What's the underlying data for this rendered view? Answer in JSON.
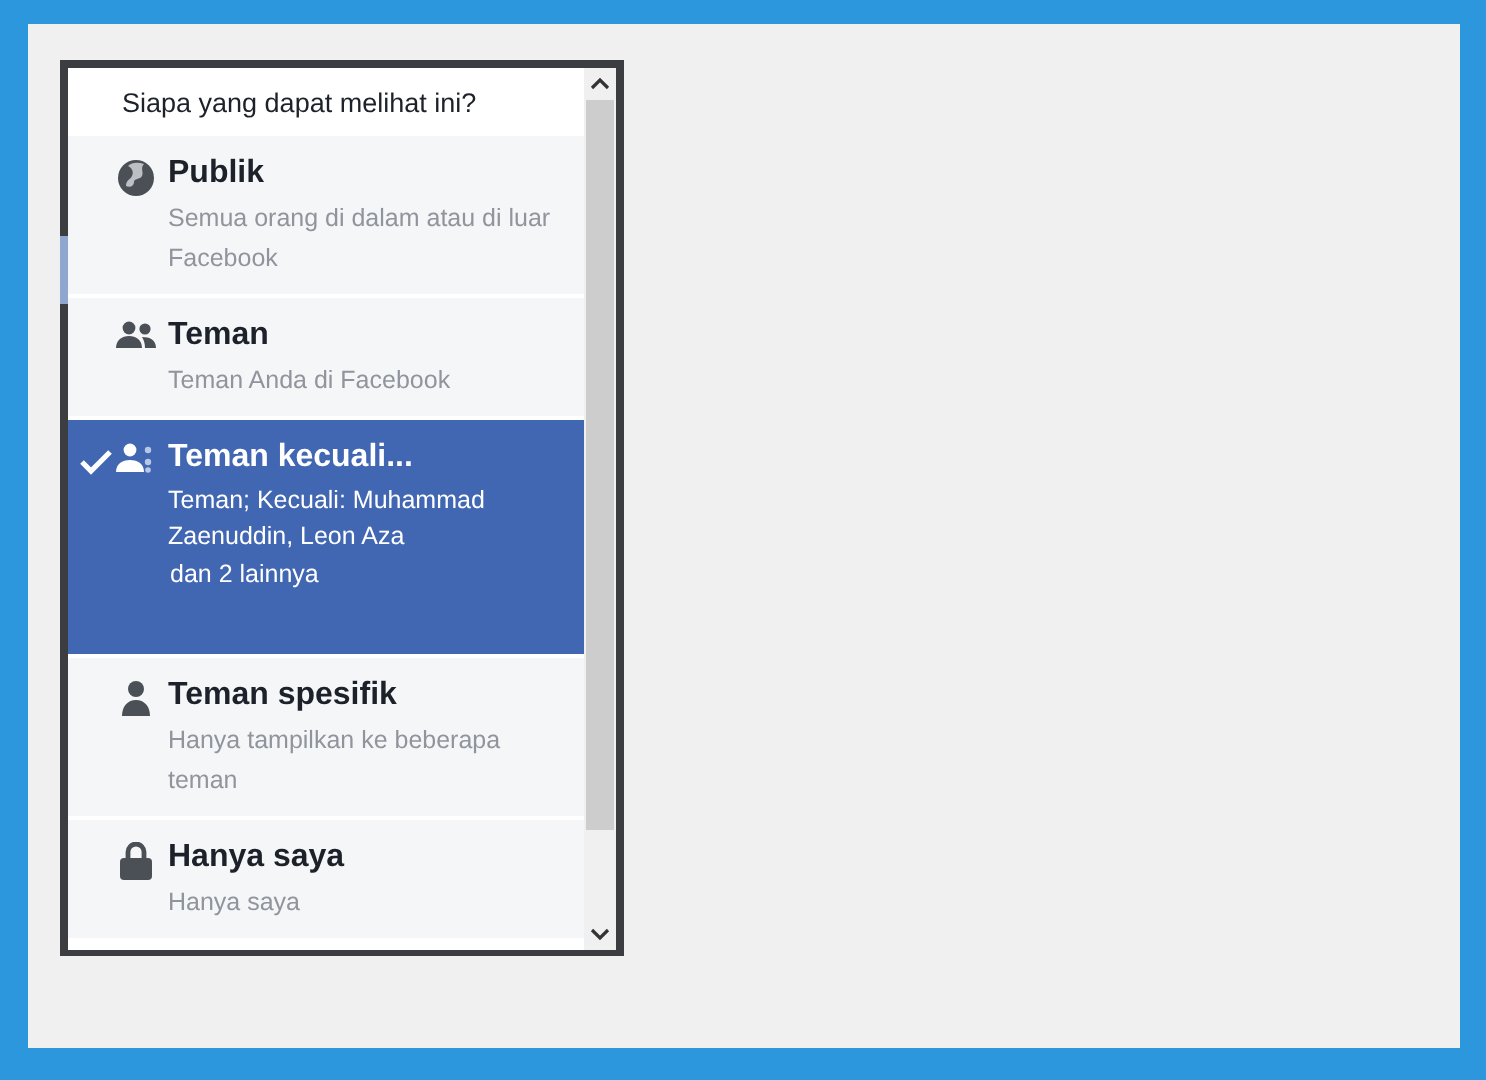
{
  "menu": {
    "title": "Siapa yang dapat melihat ini?",
    "items": [
      {
        "kind": "globe",
        "label": "Publik",
        "description": "Semua orang di dalam atau di luar Facebook",
        "selected": false
      },
      {
        "kind": "friends",
        "label": "Teman",
        "description": "Teman Anda di Facebook",
        "selected": false
      },
      {
        "kind": "friends-except",
        "label": "Teman kecuali...",
        "description": "Teman; Kecuali: Muhammad Zaenuddin, Leon Aza",
        "extra": "dan 2 lainnya",
        "selected": true
      },
      {
        "kind": "person",
        "label": "Teman spesifik",
        "description": "Hanya tampilkan ke beberapa teman",
        "selected": false
      },
      {
        "kind": "lock",
        "label": "Hanya saya",
        "description": "Hanya saya",
        "selected": false
      }
    ]
  }
}
